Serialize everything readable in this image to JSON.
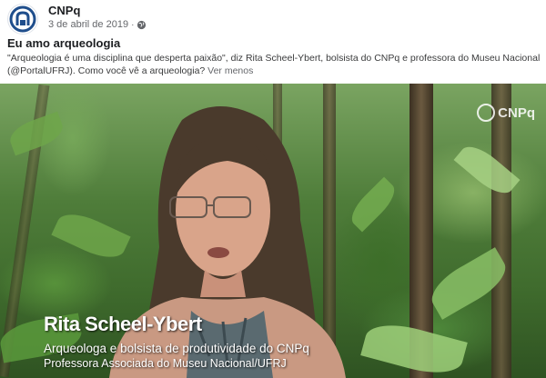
{
  "post": {
    "page_name": "CNPq",
    "date": "3 de abril de 2019",
    "separator": "·",
    "privacy_icon": "globe-icon",
    "title": "Eu amo arqueologia",
    "text": "\"Arqueologia é uma disciplina que desperta paixão\", diz Rita Scheel-Ybert, bolsista do CNPq e professora do Museu Nacional (@PortalUFRJ). Como você vê a arqueologia? ",
    "see_more": "Ver menos"
  },
  "video": {
    "watermark": "CNPq",
    "speaker_name": "Rita Scheel-Ybert",
    "speaker_role": "Arqueologa e bolsista de produtividade do CNPq",
    "speaker_institution": "Professora Associada do Museu Nacional/UFRJ"
  },
  "colors": {
    "brand_blue": "#1f4e8c",
    "link_gray": "#65676b"
  }
}
